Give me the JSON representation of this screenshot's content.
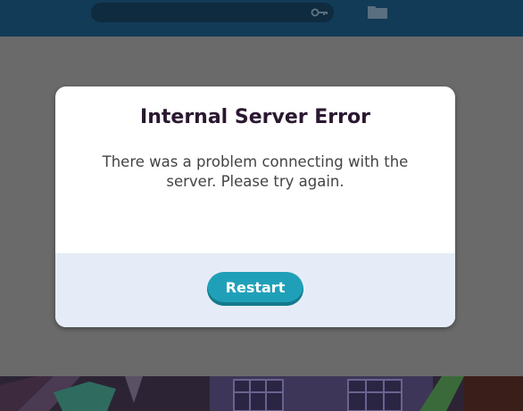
{
  "topbar": {
    "field_icon": "key-icon",
    "folder_icon": "folder-icon"
  },
  "modal": {
    "title": "Internal Server Error",
    "message": "There was a problem connecting with the server. Please try again.",
    "restart_label": "Restart"
  },
  "colors": {
    "accent": "#20a0b8",
    "title": "#2a1830",
    "footer_bg": "#e6ecf7",
    "topbar_bg": "#123b57"
  }
}
